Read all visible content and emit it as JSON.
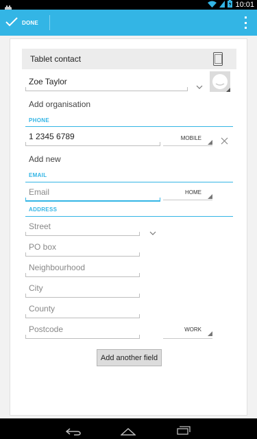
{
  "status_bar": {
    "time": "10:01"
  },
  "action_bar": {
    "done_label": "DONE"
  },
  "form": {
    "account_type": "Tablet contact",
    "name_value": "Zoe Taylor",
    "organisation_label": "Add organisation",
    "phone_header": "PHONE",
    "phone_value": "1 2345 6789",
    "phone_type": "MOBILE",
    "add_new_label": "Add new",
    "email_header": "EMAIL",
    "email_placeholder": "Email",
    "email_type": "HOME",
    "address_header": "ADDRESS",
    "address_fields": [
      "Street",
      "PO box",
      "Neighbourhood",
      "City",
      "County",
      "Postcode"
    ],
    "address_type": "WORK",
    "add_field_button": "Add another field"
  },
  "colors": {
    "accent": "#33b5e5",
    "nav": "#000000"
  }
}
